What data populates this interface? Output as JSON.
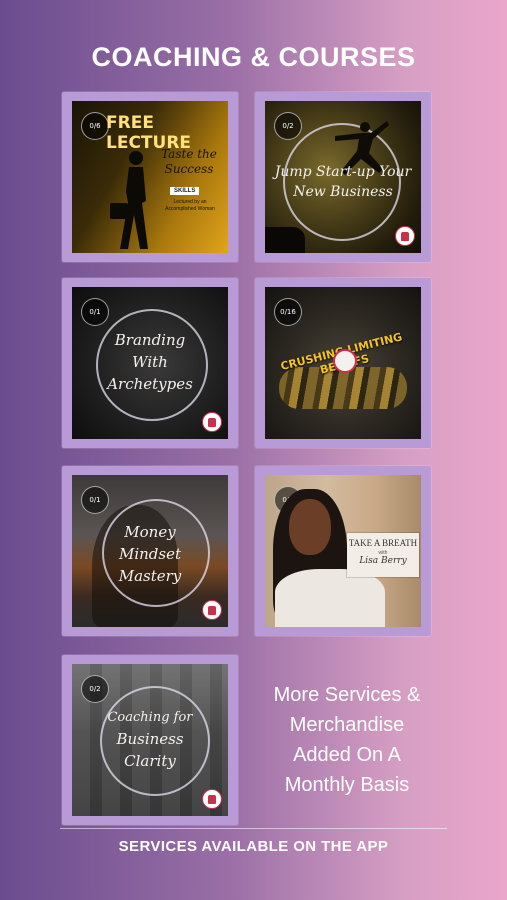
{
  "header": {
    "title": "COACHING & COURSES"
  },
  "cards": [
    {
      "badge": "0/6",
      "headline": "FREE LECTURE",
      "subtitle": "Taste the Success",
      "tag": "SKILLS",
      "note": "Lectured by an Accomplished Woman"
    },
    {
      "badge": "0/2",
      "title_line1": "Jump Start-up Your",
      "title_line2": "New Business"
    },
    {
      "badge": "0/1",
      "title_line1": "Branding",
      "title_line2": "With",
      "title_line3": "Archetypes"
    },
    {
      "badge": "0/16",
      "title": "CRUSHING LIMITING BELIEFS"
    },
    {
      "badge": "0/1",
      "title_line1": "Money",
      "title_line2": "Mindset",
      "title_line3": "Mastery"
    },
    {
      "badge": "0/4",
      "title_line1": "TAKE A BREATH",
      "with": "with",
      "author": "Lisa Berry"
    },
    {
      "badge": "0/2",
      "title_line1": "Coaching for",
      "title_line2": "Business",
      "title_line3": "Clarity"
    }
  ],
  "info": {
    "line1": "More Services &",
    "line2": "Merchandise",
    "line3": "Added On A",
    "line4": "Monthly Basis"
  },
  "footer": {
    "text": "SERVICES AVAILABLE ON THE APP"
  },
  "colors": {
    "card_frame": "#b89ad6",
    "bg_left": "#6a4c8e",
    "bg_right": "#eaa6cb"
  }
}
